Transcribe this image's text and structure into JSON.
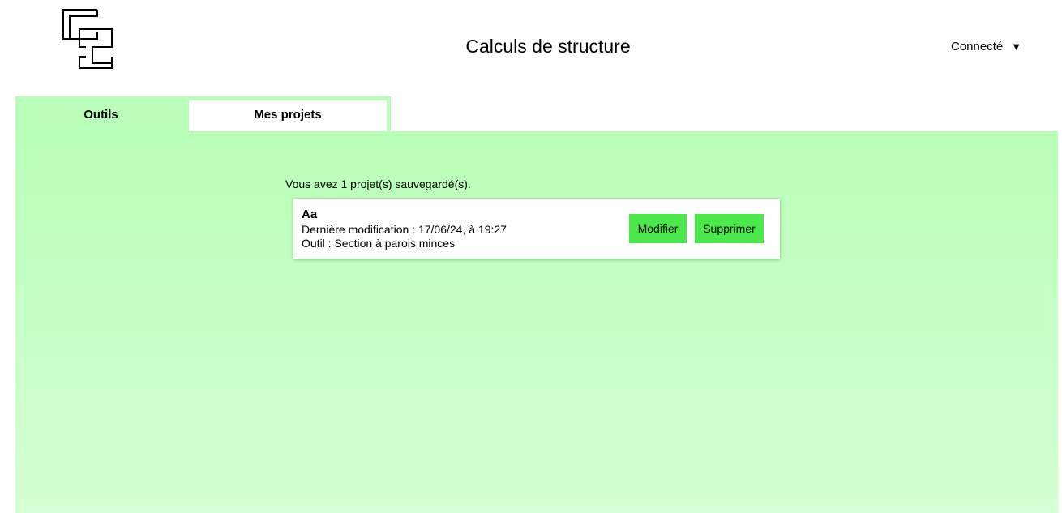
{
  "header": {
    "title": "Calculs de structure",
    "user_menu_label": "Connecté",
    "user_menu_caret": "▼",
    "logo_icon": "cs-logo-icon"
  },
  "tabs": [
    {
      "label": "Outils",
      "active": false
    },
    {
      "label": "Mes projets",
      "active": true
    }
  ],
  "projects": {
    "count_text": "Vous avez 1 projet(s) sauvegardé(s).",
    "items": [
      {
        "name": "Aa",
        "last_modified": "Dernière modification : 17/06/24, à 19:27",
        "tool": "Outil : Section à parois minces",
        "edit_label": "Modifier",
        "delete_label": "Supprimer"
      }
    ]
  },
  "colors": {
    "accent_green": "#b8feb8",
    "button_green": "#4be84b",
    "card_bg": "#ffffff"
  }
}
